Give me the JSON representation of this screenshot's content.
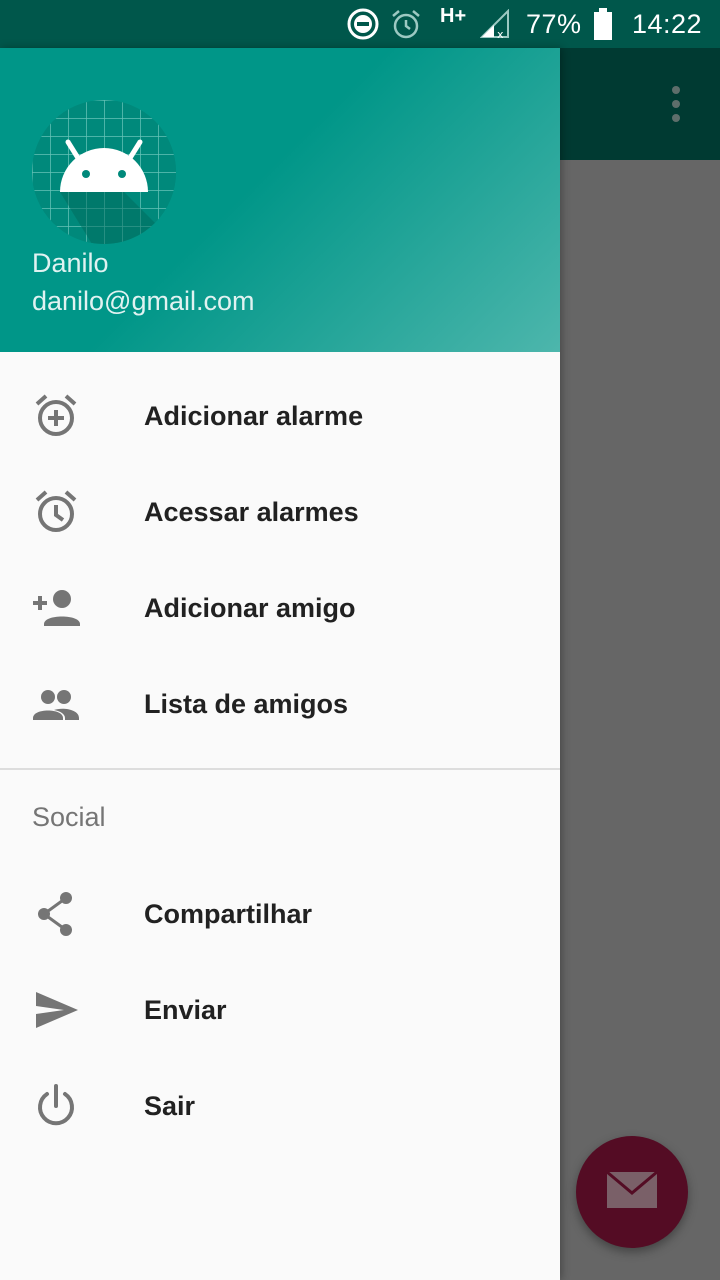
{
  "status_bar": {
    "network": "H+",
    "battery": "77%",
    "time": "14:22",
    "icons": [
      "do-not-disturb-icon",
      "alarm-icon",
      "signal-icon",
      "battery-icon"
    ]
  },
  "drawer": {
    "user": {
      "name": "Danilo",
      "email": "danilo@gmail.com",
      "avatar_icon": "android-icon"
    },
    "items": [
      {
        "label": "Adicionar alarme",
        "icon": "alarm-add-icon"
      },
      {
        "label": "Acessar alarmes",
        "icon": "alarm-icon"
      },
      {
        "label": "Adicionar amigo",
        "icon": "person-add-icon"
      },
      {
        "label": "Lista de amigos",
        "icon": "people-icon"
      }
    ],
    "section": {
      "title": "Social",
      "items": [
        {
          "label": "Compartilhar",
          "icon": "share-icon"
        },
        {
          "label": "Enviar",
          "icon": "send-icon"
        },
        {
          "label": "Sair",
          "icon": "power-icon"
        }
      ]
    }
  },
  "app": {
    "fab_icon": "email-icon",
    "overflow_icon": "more-vert-icon"
  },
  "colors": {
    "primary_dark": "#00574B",
    "primary": "#009688",
    "accent": "#540C24",
    "scrim": "#666666"
  }
}
